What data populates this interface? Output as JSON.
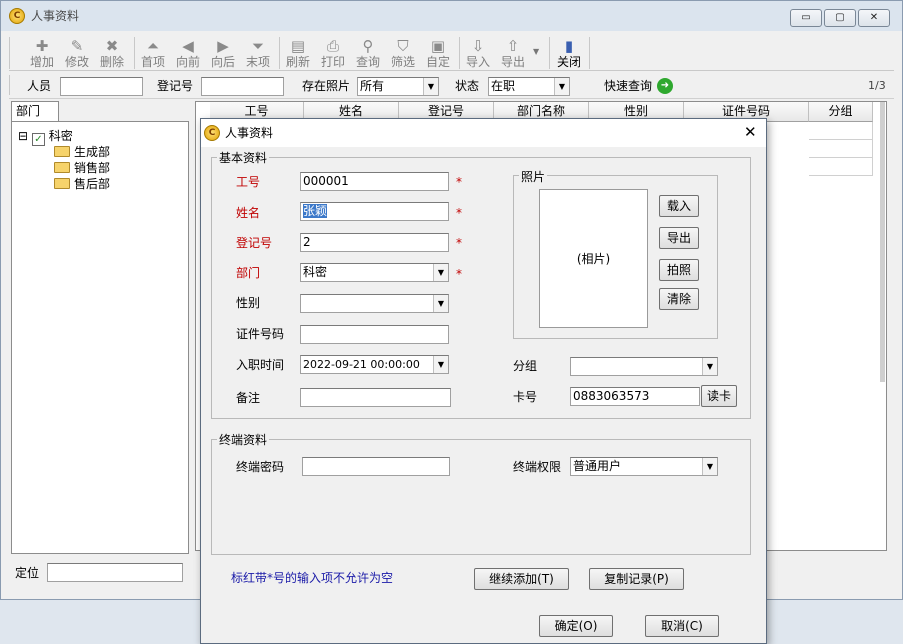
{
  "main_window": {
    "title": "人事资料",
    "controls": {
      "minimize": "▭",
      "maximize": "▢",
      "close": "✕"
    }
  },
  "toolbar": {
    "items": [
      {
        "label": "增加",
        "icon": "plus-icon",
        "glyph": "✚"
      },
      {
        "label": "修改",
        "icon": "edit-icon",
        "glyph": "✎"
      },
      {
        "label": "删除",
        "icon": "delete-icon",
        "glyph": "✖"
      },
      {
        "label": "首项",
        "icon": "first-icon",
        "glyph": "⏶"
      },
      {
        "label": "向前",
        "icon": "prev-icon",
        "glyph": "◀"
      },
      {
        "label": "向后",
        "icon": "next-icon",
        "glyph": "▶"
      },
      {
        "label": "末项",
        "icon": "last-icon",
        "glyph": "⏷"
      },
      {
        "label": "刷新",
        "icon": "refresh-icon",
        "glyph": "▤"
      },
      {
        "label": "打印",
        "icon": "print-icon",
        "glyph": "⎙"
      },
      {
        "label": "查询",
        "icon": "query-icon",
        "glyph": "⚲"
      },
      {
        "label": "筛选",
        "icon": "filter-icon",
        "glyph": "⛉"
      },
      {
        "label": "自定",
        "icon": "custom-icon",
        "glyph": "▣"
      },
      {
        "label": "导入",
        "icon": "import-icon",
        "glyph": "⇩"
      },
      {
        "label": "导出",
        "icon": "export-icon",
        "glyph": "⇧"
      },
      {
        "label": "关闭",
        "icon": "close-door-icon",
        "glyph": "▮"
      }
    ]
  },
  "filter": {
    "person_label": "人员",
    "person_value": "",
    "regno_label": "登记号",
    "regno_value": "",
    "photo_label": "存在照片",
    "photo_value": "所有",
    "status_label": "状态",
    "status_value": "在职",
    "quick_query": "快速查询",
    "page_indicator": "1/3"
  },
  "left_panel": {
    "tab": "部门",
    "tree": {
      "root": "科密",
      "root_toggle": "⊟",
      "children": [
        "生成部",
        "销售部",
        "售后部"
      ]
    },
    "locate_label": "定位",
    "locate_value": ""
  },
  "grid": {
    "columns": [
      "工号",
      "姓名",
      "登记号",
      "部门名称",
      "性别",
      "证件号码",
      "分组"
    ]
  },
  "dialog": {
    "title": "人事资料",
    "close": "✕",
    "basic_group": "基本资料",
    "fields": {
      "emp_no_label": "工号",
      "emp_no_value": "000001",
      "name_label": "姓名",
      "name_value": "张颖",
      "regno_label": "登记号",
      "regno_value": "2",
      "dept_label": "部门",
      "dept_value": "科密",
      "gender_label": "性别",
      "gender_value": "",
      "id_label": "证件号码",
      "id_value": "",
      "hire_label": "入职时间",
      "hire_value": "2022-09-21 00:00:00",
      "remark_label": "备注",
      "remark_value": "",
      "group_label": "分组",
      "group_value": "",
      "card_label": "卡号",
      "card_value": "0883063573",
      "required_mark": "*"
    },
    "photo": {
      "group": "照片",
      "placeholder": "(相片)",
      "load": "载入",
      "export": "导出",
      "capture": "拍照",
      "clear": "清除"
    },
    "read_card": "读卡",
    "terminal_group": "终端资料",
    "terminal_password_label": "终端密码",
    "terminal_password_value": "",
    "terminal_permission_label": "终端权限",
    "terminal_permission_value": "普通用户",
    "hint": "标红带*号的输入项不允许为空",
    "continue_add": "继续添加(T)",
    "copy_record": "复制记录(P)",
    "ok": "确定(O)",
    "cancel": "取消(C)"
  },
  "colors": {
    "required_red": "#c00000",
    "hint_blue": "#1a1aa8",
    "quick_query_green": "#2ea82e"
  }
}
